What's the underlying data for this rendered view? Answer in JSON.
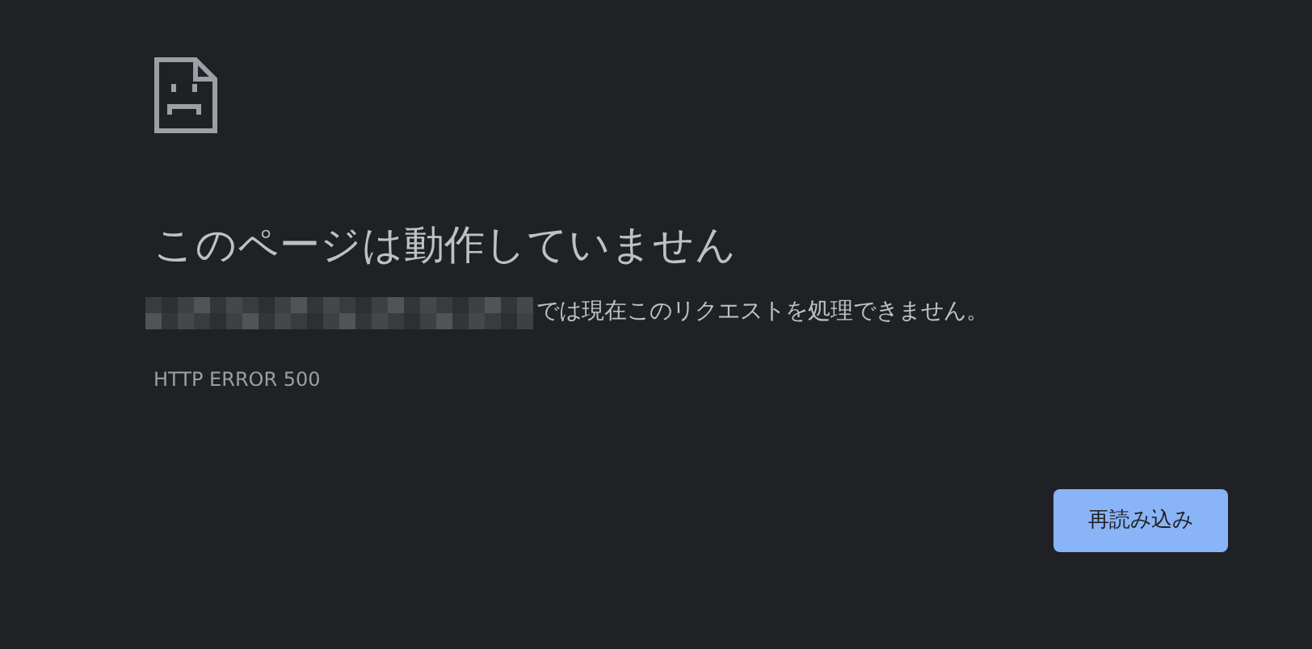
{
  "title": "このページは動作していません",
  "message": "では現在このリクエストを処理できません。",
  "error_code": "HTTP ERROR 500",
  "reload_button": {
    "label": "再読み込み"
  }
}
